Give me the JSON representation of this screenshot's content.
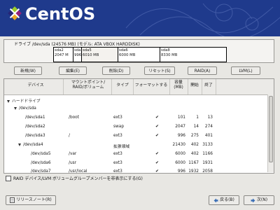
{
  "banner": {
    "brand": "CentOS"
  },
  "drive": {
    "title": "ドライブ  /dev/sda (24576 MB) (モデル: ATA VBOX HARDDISK)",
    "segments": [
      {
        "name": "sda2",
        "size": "2047 M"
      },
      {
        "name": "sda3",
        "size": "996"
      },
      {
        "name": "sda5",
        "size": "6010 MB"
      },
      {
        "name": "sda6",
        "size": "6000 MB"
      },
      {
        "name": "sda8",
        "size": "8330 MB"
      }
    ]
  },
  "toolbar": {
    "new": "新規(W)",
    "edit": "編集(E)",
    "delete": "削除(D)",
    "reset": "リセット(S)",
    "raid": "RAID(A)",
    "lvm": "LVM(L)"
  },
  "table": {
    "headers": {
      "device": "デバイス",
      "mount": "マウントポイント/\nRAID/ボリューム",
      "type": "タイプ",
      "format": "フォーマットする",
      "size": "容量\n(MB)",
      "start": "開始",
      "end": "終了"
    },
    "rows": [
      {
        "device": "ハードドライブ",
        "mount": "",
        "type": "",
        "format": false,
        "size": "",
        "start": "",
        "end": ""
      },
      {
        "device": "/dev/sda",
        "mount": "",
        "type": "",
        "format": false,
        "size": "",
        "start": "",
        "end": ""
      },
      {
        "device": "/dev/sda1",
        "mount": "/boot",
        "type": "ext3",
        "format": true,
        "size": "101",
        "start": "1",
        "end": "13"
      },
      {
        "device": "/dev/sda2",
        "mount": "",
        "type": "swap",
        "format": true,
        "size": "2047",
        "start": "14",
        "end": "274"
      },
      {
        "device": "/dev/sda3",
        "mount": "/",
        "type": "ext3",
        "format": true,
        "size": "996",
        "start": "275",
        "end": "401"
      },
      {
        "device": "/dev/sda4",
        "mount": "",
        "type": "拡張領域",
        "format": false,
        "size": "21430",
        "start": "402",
        "end": "3133"
      },
      {
        "device": "/dev/sda5",
        "mount": "/var",
        "type": "ext3",
        "format": true,
        "size": "6000",
        "start": "402",
        "end": "1166"
      },
      {
        "device": "/dev/sda6",
        "mount": "/usr",
        "type": "ext3",
        "format": true,
        "size": "6000",
        "start": "1167",
        "end": "1931"
      },
      {
        "device": "/dev/sda7",
        "mount": "/usr/local",
        "type": "ext3",
        "format": true,
        "size": "996",
        "start": "1932",
        "end": "2058"
      }
    ],
    "check_glyph": "✔"
  },
  "hide_raid_label": "RAID デバイス/LVM ボリュームグループメンバーを非表示にする(G)",
  "bottom": {
    "release_notes": "リリースノート(R)",
    "back": "戻る(B)",
    "next": "次(N)"
  },
  "colors": {
    "banner": "#1f3a8c"
  }
}
